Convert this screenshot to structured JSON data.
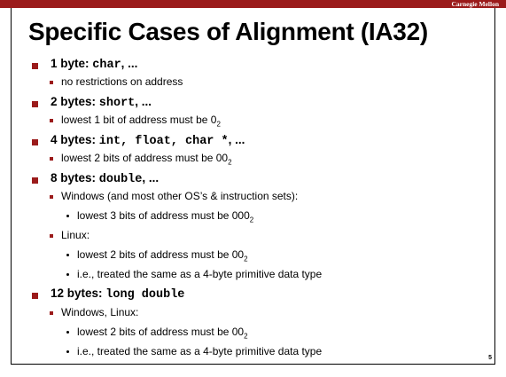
{
  "header": {
    "brand": "Carnegie Mellon"
  },
  "slide": {
    "title": "Specific Cases of Alignment (IA32)",
    "page_number": "5"
  },
  "items": [
    {
      "level": 1,
      "text": "1 byte: ",
      "code": "char",
      "suffix": ", ..."
    },
    {
      "level": 2,
      "text": "no restrictions on address"
    },
    {
      "level": 1,
      "text": "2 bytes: ",
      "code": "short",
      "suffix": ", ..."
    },
    {
      "level": 2,
      "text": "lowest 1 bit of address must be 0",
      "sub": "2"
    },
    {
      "level": 1,
      "text": "4 bytes: ",
      "code": "int, float, char *",
      "suffix": ", ..."
    },
    {
      "level": 2,
      "text": "lowest 2 bits of address must be 00",
      "sub": "2"
    },
    {
      "level": 1,
      "text": "8 bytes: ",
      "code": "double",
      "suffix": ", ..."
    },
    {
      "level": 2,
      "text": "Windows (and most other OS’s & instruction sets):"
    },
    {
      "level": 3,
      "text": "lowest 3 bits of address must be 000",
      "sub": "2"
    },
    {
      "level": 2,
      "text": "Linux:"
    },
    {
      "level": 3,
      "text": "lowest 2 bits of address must be 00",
      "sub": "2"
    },
    {
      "level": 3,
      "text": "i.e., treated the same as a 4-byte primitive data type"
    },
    {
      "level": 1,
      "text": "12 bytes: ",
      "code": "long double",
      "suffix": ""
    },
    {
      "level": 2,
      "text": "Windows, Linux:"
    },
    {
      "level": 3,
      "text": "lowest 2 bits of address must be 00",
      "sub": "2"
    },
    {
      "level": 3,
      "text": "i.e., treated the same as a 4-byte primitive data type"
    }
  ]
}
